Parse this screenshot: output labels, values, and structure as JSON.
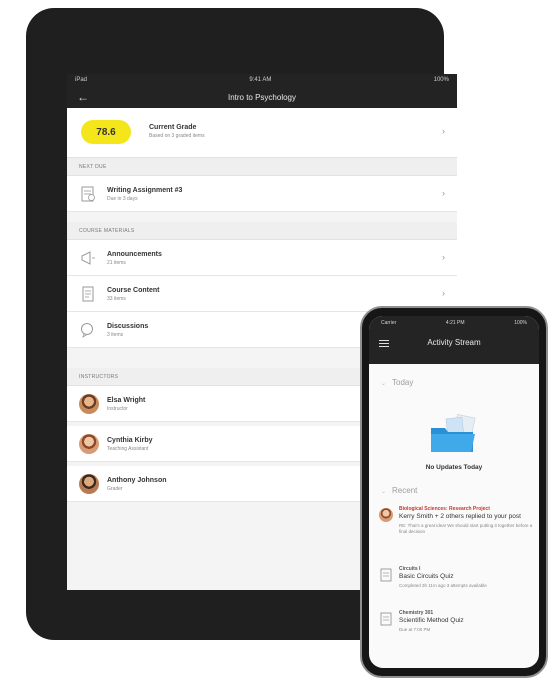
{
  "tablet": {
    "status": {
      "left": "iPad",
      "time": "9:41 AM",
      "battery": "100%"
    },
    "header": {
      "title": "Intro to Psychology"
    },
    "grade": {
      "value": "78.6",
      "title": "Current Grade",
      "subtitle": "Based on 3 graded items"
    },
    "next_due": {
      "label": "NEXT DUE",
      "item": {
        "title": "Writing Assignment #3",
        "subtitle": "Due in 3 days"
      }
    },
    "course_materials": {
      "label": "COURSE MATERIALS",
      "items": [
        {
          "title": "Announcements",
          "subtitle": "21 items"
        },
        {
          "title": "Course Content",
          "subtitle": "33 items"
        },
        {
          "title": "Discussions",
          "subtitle": "3 items"
        }
      ]
    },
    "instructors": {
      "label": "INSTRUCTORS",
      "items": [
        {
          "name": "Elsa Wright",
          "role": "Instructor"
        },
        {
          "name": "Cynthia Kirby",
          "role": "Teaching Assistant"
        },
        {
          "name": "Anthony Johnson",
          "role": "Grader"
        }
      ]
    }
  },
  "phone": {
    "status": {
      "left": "Carrier",
      "time": "4:21 PM",
      "battery": "100%"
    },
    "title": "Activity Stream",
    "today_label": "Today",
    "no_updates": "No Updates Today",
    "recent_label": "Recent",
    "feed": [
      {
        "course": "Biological Sciences: Research Project",
        "main": "Kerry Smith + 2 others replied to your post",
        "meta": "RE: That's a great idea! We should start putting it together before a final decision"
      },
      {
        "course": "Circuits I",
        "main": "Basic Circuits Quiz",
        "meta": "Completed 3h 11m ago 3 attempts available"
      },
      {
        "course": "Chemistry 301",
        "main": "Scientific Method Quiz",
        "meta": "Due at 7:00 PM"
      }
    ]
  },
  "colors": {
    "grade_pill": "#f5e61c",
    "header_bg": "#232323",
    "course_link": "#c0392b"
  },
  "icons": [
    "back-arrow-icon",
    "document-icon",
    "megaphone-icon",
    "content-icon",
    "discussion-icon",
    "chevron-right-icon",
    "hamburger-icon",
    "folder-icon"
  ]
}
